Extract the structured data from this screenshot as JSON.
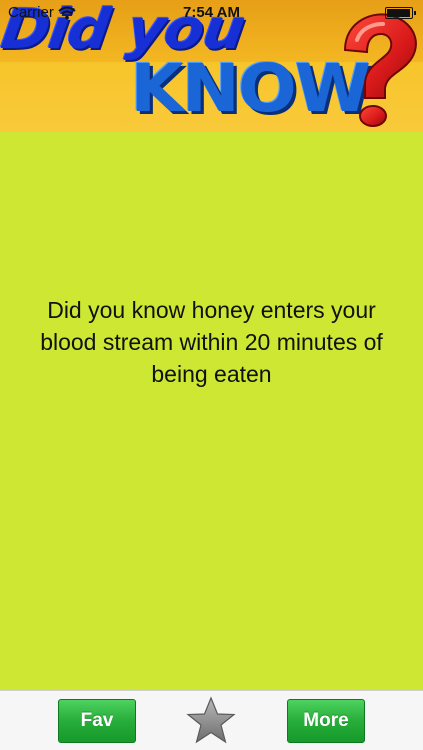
{
  "status_bar": {
    "carrier": "Carrier",
    "time": "7:54 AM"
  },
  "banner": {
    "line1": "Did you",
    "line2": "KNOW",
    "icon": "question-mark-icon"
  },
  "fact": {
    "text": "Did you know honey enters your blood stream within 20 minutes of being eaten"
  },
  "toolbar": {
    "fav_label": "Fav",
    "more_label": "More",
    "star_icon": "star-icon"
  },
  "colors": {
    "background": "#cde733",
    "button_green": "#27ad3a",
    "logo_blue": "#1730d6",
    "question_red": "#d8191a"
  }
}
